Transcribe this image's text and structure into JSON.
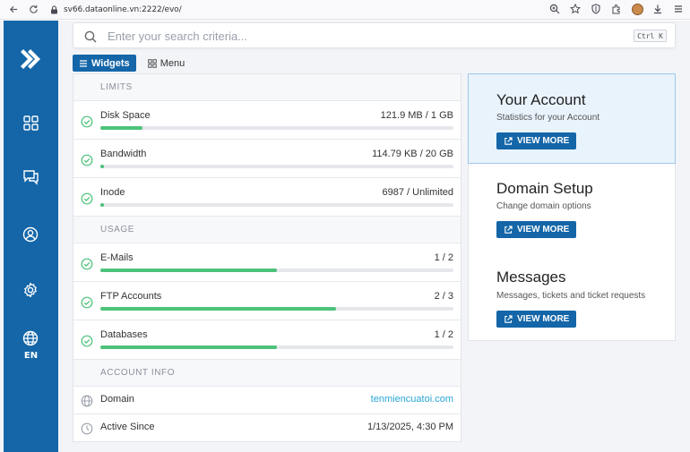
{
  "browser": {
    "url": "sv66.dataonline.vn:2222/evo/"
  },
  "sidebar": {
    "language": "EN"
  },
  "search": {
    "placeholder": "Enter your search criteria...",
    "shortcut": "Ctrl K"
  },
  "tabs": [
    {
      "label": "Widgets",
      "active": true
    },
    {
      "label": "Menu",
      "active": false
    }
  ],
  "limits": {
    "heading": "LIMITS",
    "items": [
      {
        "label": "Disk Space",
        "value": "121.9 MB / 1 GB",
        "progress": 0.12
      },
      {
        "label": "Bandwidth",
        "value": "114.79 KB / 20 GB",
        "progress": 0.005
      },
      {
        "label": "Inode",
        "value": "6987 / Unlimited",
        "progress": 0.005
      }
    ]
  },
  "usage": {
    "heading": "USAGE",
    "items": [
      {
        "label": "E-Mails",
        "value": "1 / 2",
        "progress": 0.5
      },
      {
        "label": "FTP Accounts",
        "value": "2 / 3",
        "progress": 0.667
      },
      {
        "label": "Databases",
        "value": "1 / 2",
        "progress": 0.5
      }
    ]
  },
  "account_info": {
    "heading": "ACCOUNT INFO",
    "domain_label": "Domain",
    "domain_value": "tenmiencuatoi.com",
    "since_label": "Active Since",
    "since_value": "1/13/2025, 4:30 PM"
  },
  "cards": [
    {
      "title": "Your Account",
      "subtitle": "Statistics for your Account",
      "button": "VIEW MORE"
    },
    {
      "title": "Domain Setup",
      "subtitle": "Change domain options",
      "button": "VIEW MORE"
    },
    {
      "title": "Messages",
      "subtitle": "Messages, tickets and ticket requests",
      "button": "VIEW MORE"
    }
  ],
  "colors": {
    "brand": "#1466a8",
    "progress": "#4cc27a",
    "check": "#4cc27a",
    "link": "#2aa7d6",
    "highlight_card": "#e9f3fc"
  }
}
